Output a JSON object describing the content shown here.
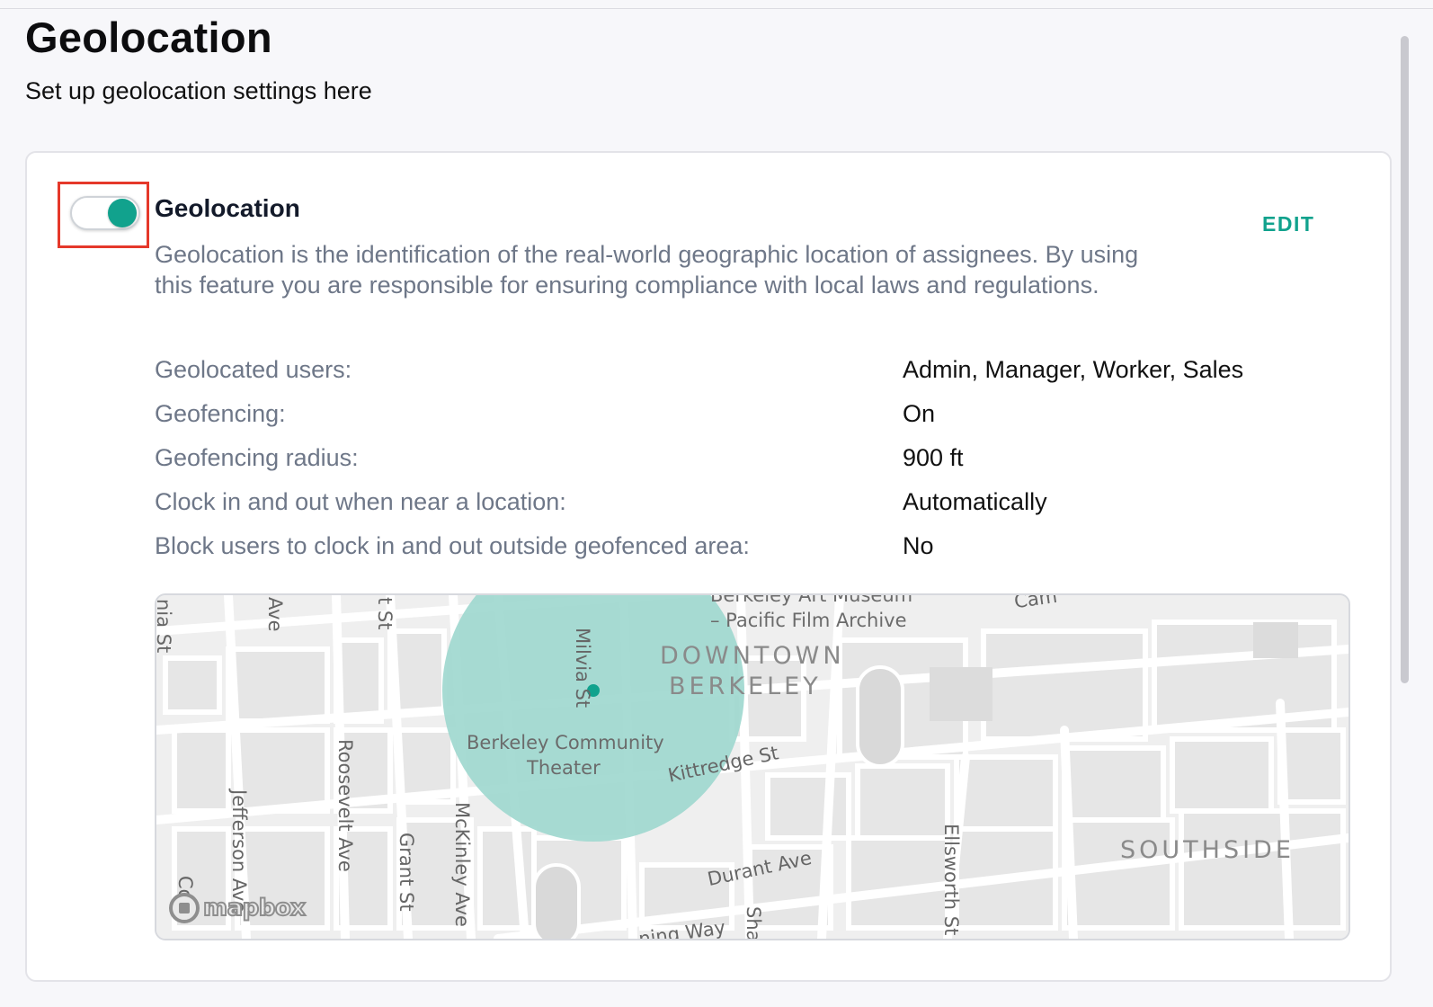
{
  "page": {
    "title": "Geolocation",
    "subtitle": "Set up geolocation settings here"
  },
  "geolocation": {
    "enabled": true,
    "title": "Geolocation",
    "edit_label": "EDIT",
    "description": "Geolocation is the identification of the real-world geographic location of assignees. By using this feature you are responsible for ensuring compliance with local laws and regulations.",
    "accent_color": "#11a28d",
    "settings": [
      {
        "label": "Geolocated users:",
        "value": "Admin, Manager, Worker, Sales"
      },
      {
        "label": "Geofencing:",
        "value": "On"
      },
      {
        "label": "Geofencing radius:",
        "value": "900 ft"
      },
      {
        "label": "Clock in and out when near a location:",
        "value": "Automatically"
      },
      {
        "label": "Block users to clock in and out outside geofenced area:",
        "value": "No"
      }
    ]
  },
  "map": {
    "provider": "mapbox",
    "geofence_color": "#9fd8cf",
    "center_color": "#11a28d",
    "labels": {
      "milvia": "Milvia St",
      "downtown_1": "DOWNTOWN",
      "downtown_2": "BERKELEY",
      "museum_1": "Berkeley Art Museum",
      "museum_2": "– Pacific Film Archive",
      "campus": "Cam",
      "theater_1": "Berkeley Community",
      "theater_2": "Theater",
      "kittredge": "Kittredge St",
      "roosevelt": "Roosevelt Ave",
      "jefferson": "Jefferson Ave",
      "grant": "Grant St",
      "mckinley": "McKinley Ave",
      "durant": "Durant Ave",
      "ellsworth": "Ellsworth St",
      "southside": "SOUTHSIDE",
      "shattuck": "Sha",
      "haste": "ning Way",
      "california": "nia St",
      "ave_top": "Ave",
      "st_top": "t St",
      "co_left": "Co"
    }
  }
}
